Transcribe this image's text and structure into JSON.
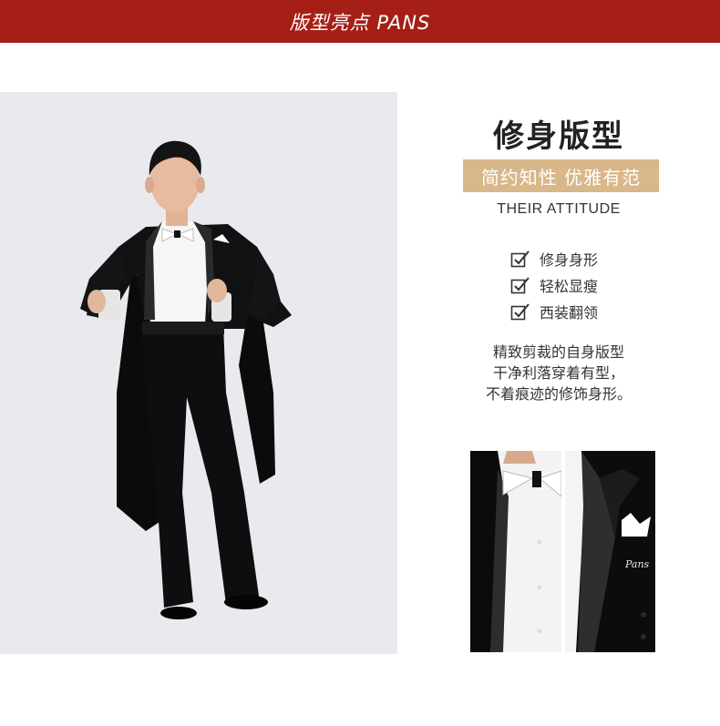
{
  "banner": {
    "title": "版型亮点 PANS"
  },
  "heading": {
    "title": "修身版型"
  },
  "tagline": "简约知性 优雅有范",
  "subheading": "THEIR ATTITUDE",
  "features": [
    {
      "label": "修身身形",
      "icon": "checkbox-check-icon"
    },
    {
      "label": "轻松显瘦",
      "icon": "checkbox-check-icon"
    },
    {
      "label": "西装翻领",
      "icon": "checkbox-check-icon"
    }
  ],
  "description": [
    "精致剪裁的自身版型",
    "干净利落穿着有型，",
    "不着痕迹的修饰身形。"
  ],
  "photos": {
    "detail_pocket_text": "Pans"
  },
  "colors": {
    "banner": "#a51f16",
    "tagline_bg": "#d8b78a",
    "photo_bg": "#e9eaee"
  }
}
